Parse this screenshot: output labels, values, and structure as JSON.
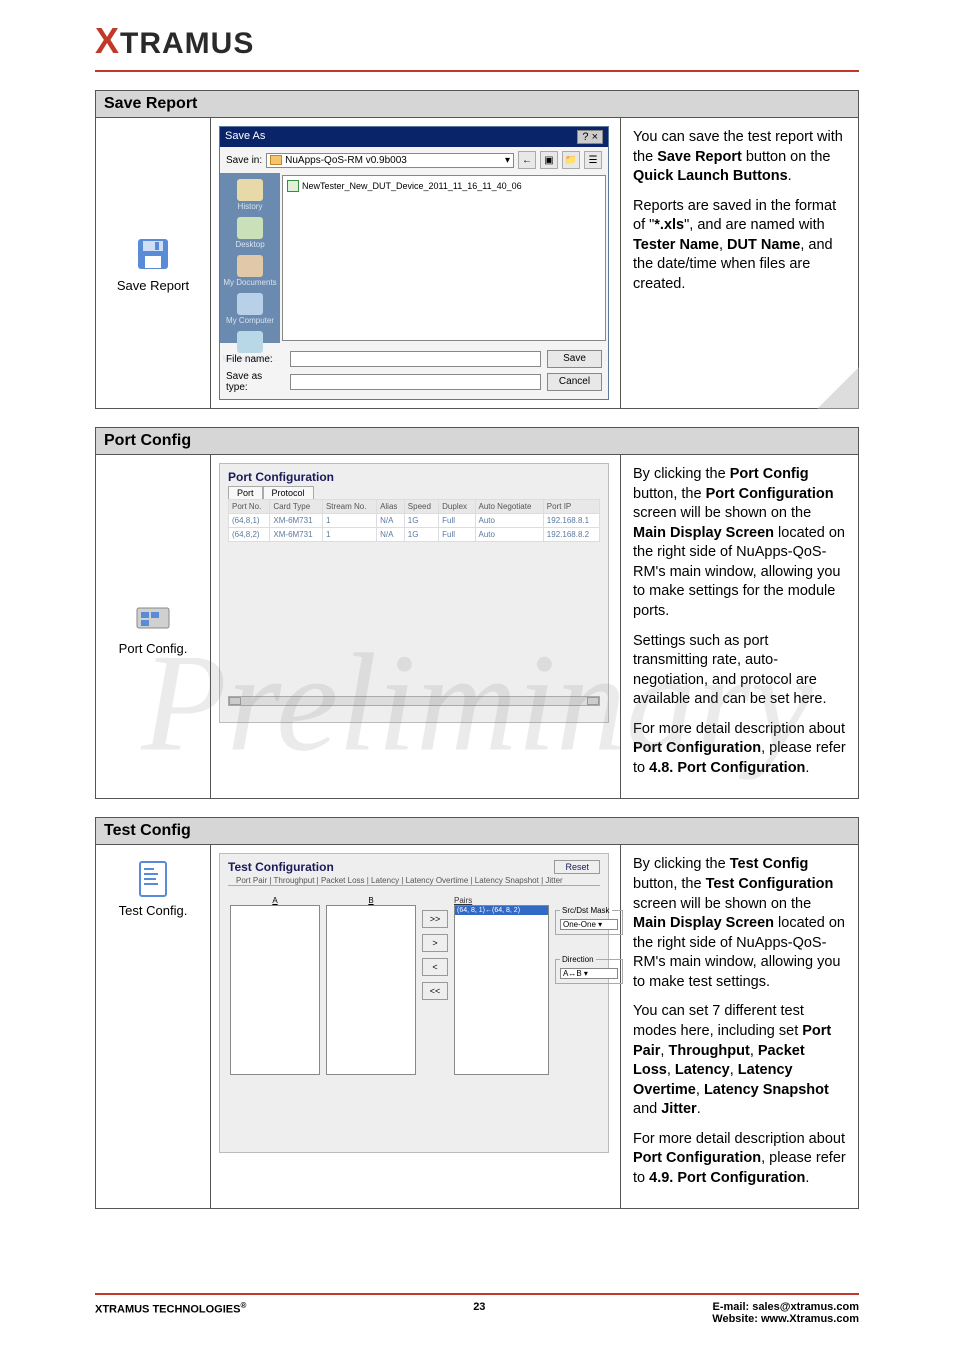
{
  "logo": {
    "x": "X",
    "rest": "TRAMUS"
  },
  "watermark": "Preliminary",
  "sections": {
    "save": {
      "title": "Save Report",
      "icon_label": "Save Report",
      "dialog": {
        "title": "Save As",
        "close": "? ×",
        "save_in_label": "Save in:",
        "save_in_value": "NuApps-QoS-RM v0.9b003",
        "toolbar_icons": [
          "←",
          "▣",
          "📁",
          "☰"
        ],
        "places": [
          "History",
          "Desktop",
          "My Documents",
          "My Computer",
          "My Network P..."
        ],
        "file_item": "NewTester_New_DUT_Device_2011_11_16_11_40_06",
        "file_name_label": "File name:",
        "save_as_type_label": "Save as type:",
        "save_btn": "Save",
        "cancel_btn": "Cancel"
      },
      "desc": {
        "p1a": "You can save the test report with the ",
        "p1b": "Save Report",
        "p1c": " button on the ",
        "p1d": "Quick Launch Buttons",
        "p1e": ".",
        "p2a": "Reports are saved in the format of \"",
        "p2b": "*.xls",
        "p2c": "\", and are named with ",
        "p2d": "Tester Name",
        "p2e": ", ",
        "p2f": "DUT Name",
        "p2g": ", and the date/time when files are created."
      }
    },
    "port": {
      "title": "Port Config",
      "icon_label": "Port Config.",
      "panel_title": "Port Configuration",
      "tabs": [
        "Port",
        "Protocol"
      ],
      "columns": [
        "Port No.",
        "Card Type",
        "Stream No.",
        "Alias",
        "Speed",
        "Duplex",
        "Auto Negotiate",
        "Port IP"
      ],
      "rows": [
        [
          "(64,8,1)",
          "XM-6M731",
          "1",
          "N/A",
          "1G",
          "Full",
          "Auto",
          "192.168.8.1"
        ],
        [
          "(64,8,2)",
          "XM-6M731",
          "1",
          "N/A",
          "1G",
          "Full",
          "Auto",
          "192.168.8.2"
        ]
      ],
      "desc": {
        "p1a": "By clicking the ",
        "p1b": "Port Config",
        "p1c": " button, the ",
        "p1d": "Port Configuration",
        "p1e": " screen will be shown on the ",
        "p1f": "Main Display Screen",
        "p1g": " located on the right side of NuApps-QoS-RM's main window, allowing you to make settings for the module ports.",
        "p2": "Settings such as port transmitting rate, auto-negotiation, and protocol are available and can be set here.",
        "p3a": "For more detail description about ",
        "p3b": "Port Configuration",
        "p3c": ", please refer to ",
        "p3d": "4.8. Port Configuration",
        "p3e": "."
      }
    },
    "test": {
      "title": "Test Config",
      "icon_label": "Test Config.",
      "panel_title": "Test Configuration",
      "reset": "Reset",
      "tabs_line": "Port Pair | Throughput | Packet Loss | Latency | Latency Overtime | Latency Snapshot | Jitter",
      "labels": {
        "A": "A",
        "B": "B",
        "pairs": "Pairs"
      },
      "buttons": [
        ">>",
        ">",
        "<",
        "<<"
      ],
      "pair_item": "(64, 8, 1)←(64, 8, 2)",
      "src_dst_legend": "Src/Dst Mask",
      "src_dst_value": "One-One",
      "direction_legend": "Direction",
      "direction_value": "A↔B",
      "desc": {
        "p1a": "By clicking the ",
        "p1b": "Test Config",
        "p1c": " button, the ",
        "p1d": "Test Configuration",
        "p1e": " screen will be shown on the ",
        "p1f": "Main Display Screen",
        "p1g": " located on the right side of NuApps-QoS-RM's main window, allowing you to make test settings.",
        "p2a": "You can set 7 different test modes here, including set ",
        "p2b": "Port Pair",
        "p2c": ", ",
        "p2d": "Throughput",
        "p2e": ", ",
        "p2f": "Packet Loss",
        "p2g": ", ",
        "p2h": "Latency",
        "p2i": ", ",
        "p2j": "Latency Overtime",
        "p2k": ", ",
        "p2l": "Latency Snapshot",
        "p2m": " and ",
        "p2n": "Jitter",
        "p2o": ".",
        "p3a": "For more detail description about ",
        "p3b": "Port Configuration",
        "p3c": ", please refer to ",
        "p3d": "4.9. Port Configuration",
        "p3e": "."
      }
    }
  },
  "footer": {
    "left": "XTRAMUS TECHNOLOGIES",
    "reg": "®",
    "page": "23",
    "email_label": "E-mail: ",
    "email": "sales@xtramus.com",
    "web_label": "Website:  ",
    "web": "www.Xtramus.com"
  }
}
